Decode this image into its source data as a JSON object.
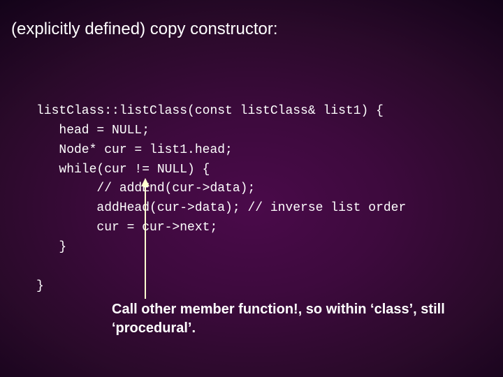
{
  "heading": "(explicitly defined) copy constructor:",
  "code": {
    "l1": "listClass::listClass(const listClass& list1) {",
    "l2": "   head = NULL;",
    "l3": "   Node* cur = list1.head;",
    "l4": "   while(cur != NULL) {",
    "l5": "        // addEnd(cur->data);",
    "l6": "        addHead(cur->data); // inverse list order",
    "l7": "        cur = cur->next;",
    "l8": "   }",
    "l9": "}"
  },
  "caption": "Call other member function!, so within ‘class’, still ‘procedural’."
}
